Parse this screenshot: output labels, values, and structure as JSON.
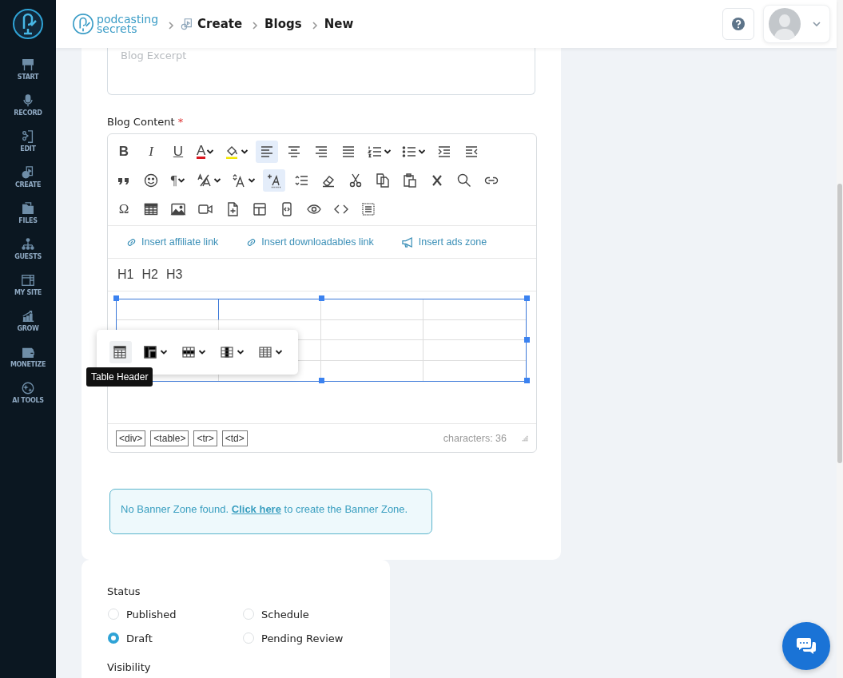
{
  "sidebar": {
    "items": [
      {
        "label": "START",
        "kind": "start"
      },
      {
        "label": "RECORD",
        "kind": "mic"
      },
      {
        "label": "EDIT",
        "kind": "edit"
      },
      {
        "label": "CREATE",
        "kind": "create"
      },
      {
        "label": "FILES",
        "kind": "folder"
      },
      {
        "label": "GUESTS",
        "kind": "people"
      },
      {
        "label": "MY SITE",
        "kind": "site"
      },
      {
        "label": "GROW",
        "kind": "chart"
      },
      {
        "label": "MONETIZE",
        "kind": "wallet"
      },
      {
        "label": "AI TOOLS",
        "kind": "ai"
      }
    ]
  },
  "header": {
    "logo": {
      "line_1": "podcasting",
      "line_2": "secrets"
    },
    "breadcrumbs": [
      {
        "label": "Create",
        "kind": "with-icon"
      },
      {
        "label": "Blogs",
        "kind": "plain"
      },
      {
        "label": "New",
        "kind": "plain"
      }
    ]
  },
  "excerpt": {
    "placeholder": "Blog Excerpt"
  },
  "content_field": {
    "label": "Blog Content",
    "required_mark": "*"
  },
  "toolbar": {
    "rows": [
      [
        {
          "kind": "bold",
          "text": "B",
          "active": false,
          "caret": false
        },
        {
          "kind": "italic",
          "text": "I",
          "active": false,
          "caret": false
        },
        {
          "kind": "underline",
          "text": "U",
          "active": false,
          "caret": false
        },
        {
          "kind": "font-color",
          "text": "A",
          "active": false,
          "caret": true
        },
        {
          "kind": "highlight",
          "active": false,
          "caret": true
        },
        {
          "kind": "align-left",
          "active": true,
          "caret": false
        },
        {
          "kind": "align-center",
          "active": false,
          "caret": false
        },
        {
          "kind": "align-right",
          "active": false,
          "caret": false
        },
        {
          "kind": "justify",
          "active": false,
          "caret": false
        },
        {
          "kind": "ordered-list",
          "active": false,
          "caret": true
        },
        {
          "kind": "bullet-list",
          "active": false,
          "caret": true
        },
        {
          "kind": "indent",
          "active": false,
          "caret": false
        },
        {
          "kind": "outdent",
          "active": false,
          "caret": false
        }
      ],
      [
        {
          "kind": "quote",
          "active": false,
          "caret": false
        },
        {
          "kind": "emoji",
          "active": false,
          "caret": false
        },
        {
          "kind": "paragraph",
          "text": "¶",
          "active": false,
          "caret": true
        },
        {
          "kind": "font-size",
          "active": false,
          "caret": true
        },
        {
          "kind": "font-family",
          "active": false,
          "caret": true
        },
        {
          "kind": "insert-format",
          "active": true,
          "caret": false
        },
        {
          "kind": "line-height",
          "active": false,
          "caret": false
        },
        {
          "kind": "eraser",
          "active": false,
          "caret": false
        },
        {
          "kind": "cut",
          "active": false,
          "caret": false
        },
        {
          "kind": "copy",
          "active": false,
          "caret": false
        },
        {
          "kind": "paste",
          "active": false,
          "caret": false
        },
        {
          "kind": "remove-format",
          "active": false,
          "caret": false
        },
        {
          "kind": "find",
          "active": false,
          "caret": false
        },
        {
          "kind": "link",
          "active": false,
          "caret": false
        }
      ],
      [
        {
          "kind": "special-char",
          "text": "Ω",
          "active": false,
          "caret": false
        },
        {
          "kind": "table",
          "active": false,
          "caret": false
        },
        {
          "kind": "image",
          "active": false,
          "caret": false
        },
        {
          "kind": "video",
          "active": false,
          "caret": false
        },
        {
          "kind": "insert-file",
          "active": false,
          "caret": false
        },
        {
          "kind": "layout",
          "active": false,
          "caret": false
        },
        {
          "kind": "code-block",
          "active": false,
          "caret": false
        },
        {
          "kind": "preview",
          "active": false,
          "caret": false
        },
        {
          "kind": "source",
          "active": false,
          "caret": false
        },
        {
          "kind": "select-all",
          "active": false,
          "caret": false
        }
      ]
    ]
  },
  "insert_links": [
    {
      "label": "Insert affiliate link",
      "kind": "link"
    },
    {
      "label": "Insert downloadables link",
      "kind": "link"
    },
    {
      "label": "Insert ads zone",
      "kind": "megaphone"
    }
  ],
  "headings": [
    "H1",
    "H2",
    "H3"
  ],
  "table_popup": {
    "buttons": [
      {
        "kind": "table-header",
        "selected": true
      },
      {
        "kind": "header-column",
        "selected": false
      },
      {
        "kind": "row",
        "selected": false
      },
      {
        "kind": "column",
        "selected": false
      },
      {
        "kind": "table-props",
        "selected": false
      }
    ],
    "tooltip": "Table Header"
  },
  "status_bar": {
    "path": [
      "<div>",
      "<table>",
      "<tr>",
      "<td>"
    ],
    "count": "characters: 36"
  },
  "banner": {
    "before": "No Banner Zone found.",
    "link": "Click here",
    "after": "to create the Banner Zone."
  },
  "status": {
    "label": "Status",
    "options": [
      {
        "label": "Published",
        "selected": false
      },
      {
        "label": "Schedule",
        "selected": false
      },
      {
        "label": "Draft",
        "selected": true
      },
      {
        "label": "Pending Review",
        "selected": false
      }
    ]
  },
  "visibility": {
    "label": "Visibility"
  }
}
